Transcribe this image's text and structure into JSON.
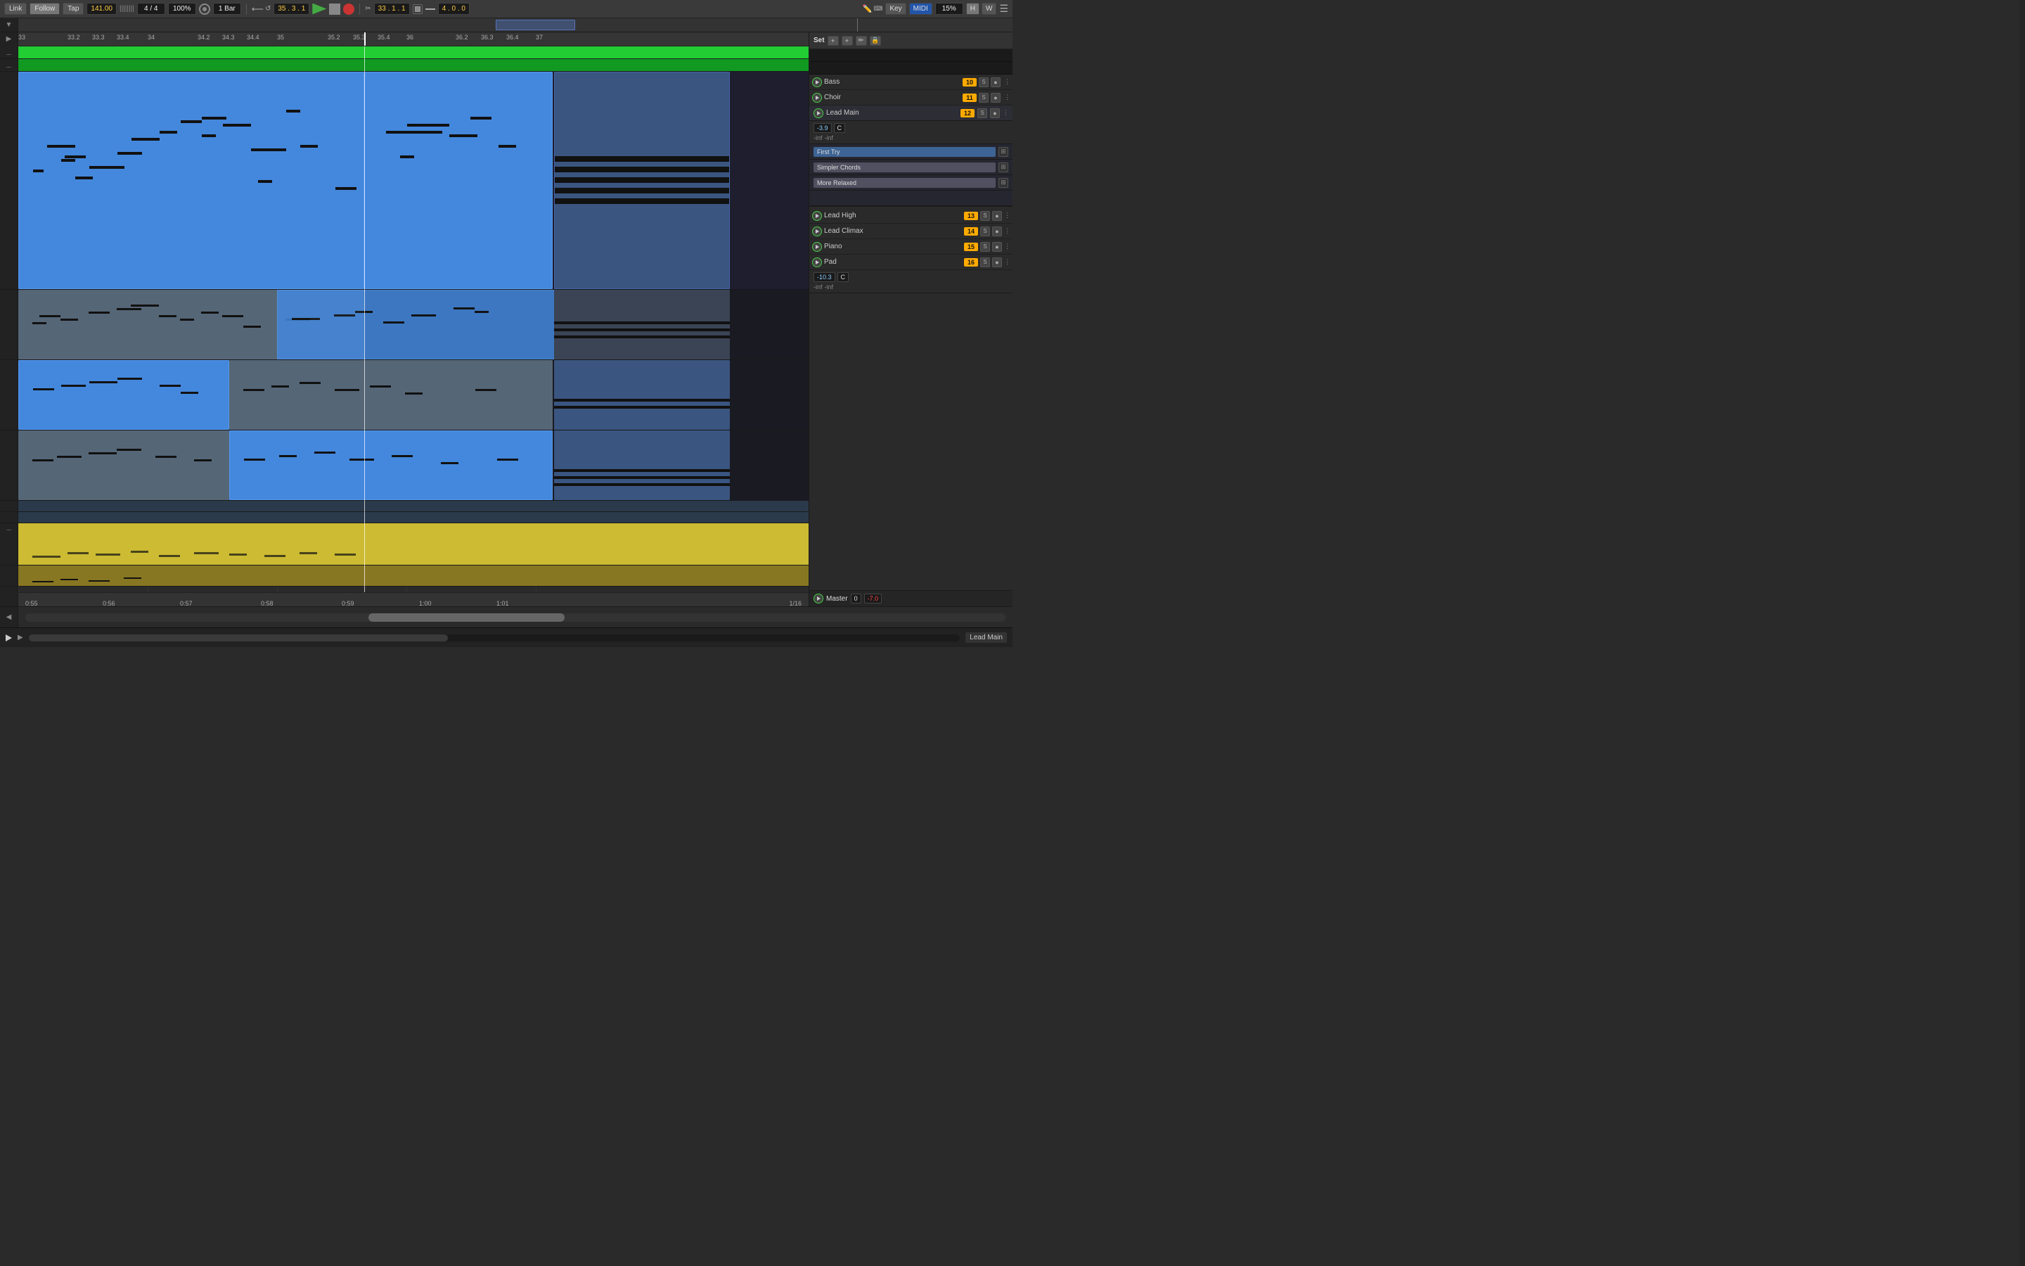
{
  "toolbar": {
    "link_label": "Link",
    "follow_label": "Follow",
    "tap_label": "Tap",
    "bpm": "141.00",
    "time_sig": "4 / 4",
    "zoom_pct": "100%",
    "quantize": "1 Bar",
    "position": "35 . 3 . 1",
    "play_label": "Play",
    "stop_label": "Stop",
    "record_label": "Record",
    "loop_pos": "33 . 1 . 1",
    "end_pos": "4 . 0 . 0",
    "key_label": "Key",
    "midi_label": "MIDI",
    "zoom_pct2": "15%",
    "hw_label": "H",
    "hw2_label": "W"
  },
  "ruler": {
    "marks": [
      "33",
      "33.2",
      "33.3",
      "33.4",
      "34",
      "34.2",
      "34.3",
      "34.4",
      "35",
      "35.2",
      "35.3",
      "35.4",
      "36",
      "36.2",
      "36.3",
      "36.4",
      "37"
    ]
  },
  "time_ruler": {
    "marks": [
      "0:55",
      "0:56",
      "0:57",
      "0:58",
      "0:59",
      "1:00",
      "1:01"
    ]
  },
  "right_panel": {
    "set_label": "Set",
    "tracks": [
      {
        "name": "Bass",
        "num": "10",
        "badge_class": "badge-orange"
      },
      {
        "name": "Choir",
        "num": "11",
        "badge_class": "badge-orange"
      },
      {
        "name": "Lead Main",
        "num": "12",
        "badge_class": "badge-orange"
      },
      {
        "name": "Lead High",
        "num": "13",
        "badge_class": "badge-orange"
      },
      {
        "name": "Lead Climax",
        "num": "14",
        "badge_class": "badge-orange"
      },
      {
        "name": "Piano",
        "num": "15",
        "badge_class": "badge-orange"
      },
      {
        "name": "Pad",
        "num": "16",
        "badge_class": "badge-orange"
      }
    ],
    "clips": {
      "lead_main": {
        "name": "Lead Main",
        "slots": [
          {
            "name": "First Try",
            "filled": true,
            "type": "blue"
          },
          {
            "name": "Simpler Chords",
            "filled": true,
            "type": "grey"
          },
          {
            "name": "More Relaxed",
            "filled": true,
            "type": "grey"
          },
          {
            "name": "",
            "filled": false
          }
        ]
      }
    },
    "lead_main_vol": "-3.9",
    "lead_main_key": "C",
    "inf_left": "-inf",
    "inf_right": "-inf",
    "lead_high_vol": "13",
    "lead_climax_vol": "14",
    "piano_vol": "15",
    "pad_vol": "16",
    "pad_db": "-10.3",
    "pad_key": "C",
    "pad_inf_left": "-inf",
    "pad_inf_right": "-inf",
    "master_label": "Master",
    "master_vol": "0",
    "master_db": "-7.0"
  },
  "bottom": {
    "status_track": "Lead Main",
    "fraction": "1/16"
  },
  "clip_names": {
    "first_try": "First Try",
    "simpler_chords": "Simpler Chords",
    "more_relaxed": "More Relaxed",
    "lead_high": "Lead High"
  }
}
